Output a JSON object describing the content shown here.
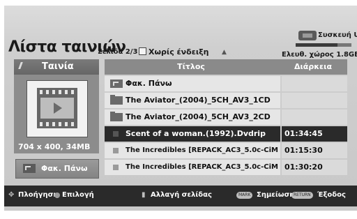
{
  "header": {
    "title": "Λίστα ταινιών",
    "page": "Σελίδα 2/3",
    "no_mark": "Χωρίς ένδειξη",
    "usb_label": "Συσκευή USB",
    "free_space": "Ελευθ. χώρος 1.8GB",
    "usb_free_fraction": 0.75
  },
  "left_panel": {
    "label": "Ταινία",
    "resolution": "704 x 400, 34MB",
    "up_button": "Φακ. Πάνω"
  },
  "table": {
    "col_title": "Τίτλος",
    "col_duration": "Διάρκεια",
    "rows": [
      {
        "icon": "folder-up-icon",
        "title": "Φακ. Πάνω",
        "duration": "",
        "selected": false
      },
      {
        "icon": "folder-icon",
        "title": "The Aviator_(2004)_5CH_AV3_1CD",
        "duration": "",
        "selected": false
      },
      {
        "icon": "folder-icon",
        "title": "The Aviator_(2004)_5CH_AV3_2CD",
        "duration": "",
        "selected": false
      },
      {
        "icon": "movie-file-icon",
        "title": "Scent of a woman.(1992).Dvdrip",
        "duration": "01:34:45",
        "selected": true
      },
      {
        "icon": "movie-file-icon",
        "title": "The Incredibles [REPACK_AC3_5.0c-CiM",
        "duration": "01:15:30",
        "selected": false
      },
      {
        "icon": "movie-file-icon",
        "title": "The Incredibles [REPACK_AC3_5.0c-CiM",
        "duration": "01:30:20",
        "selected": false
      }
    ]
  },
  "footer": {
    "navigation": "Πλοήγηση",
    "select": "Επιλογή",
    "page_change": "Αλλαγή σελίδας",
    "mark_key": "MARK",
    "mark": "Σημείωση",
    "return_key": "RETURN",
    "exit": "Έξοδος"
  }
}
